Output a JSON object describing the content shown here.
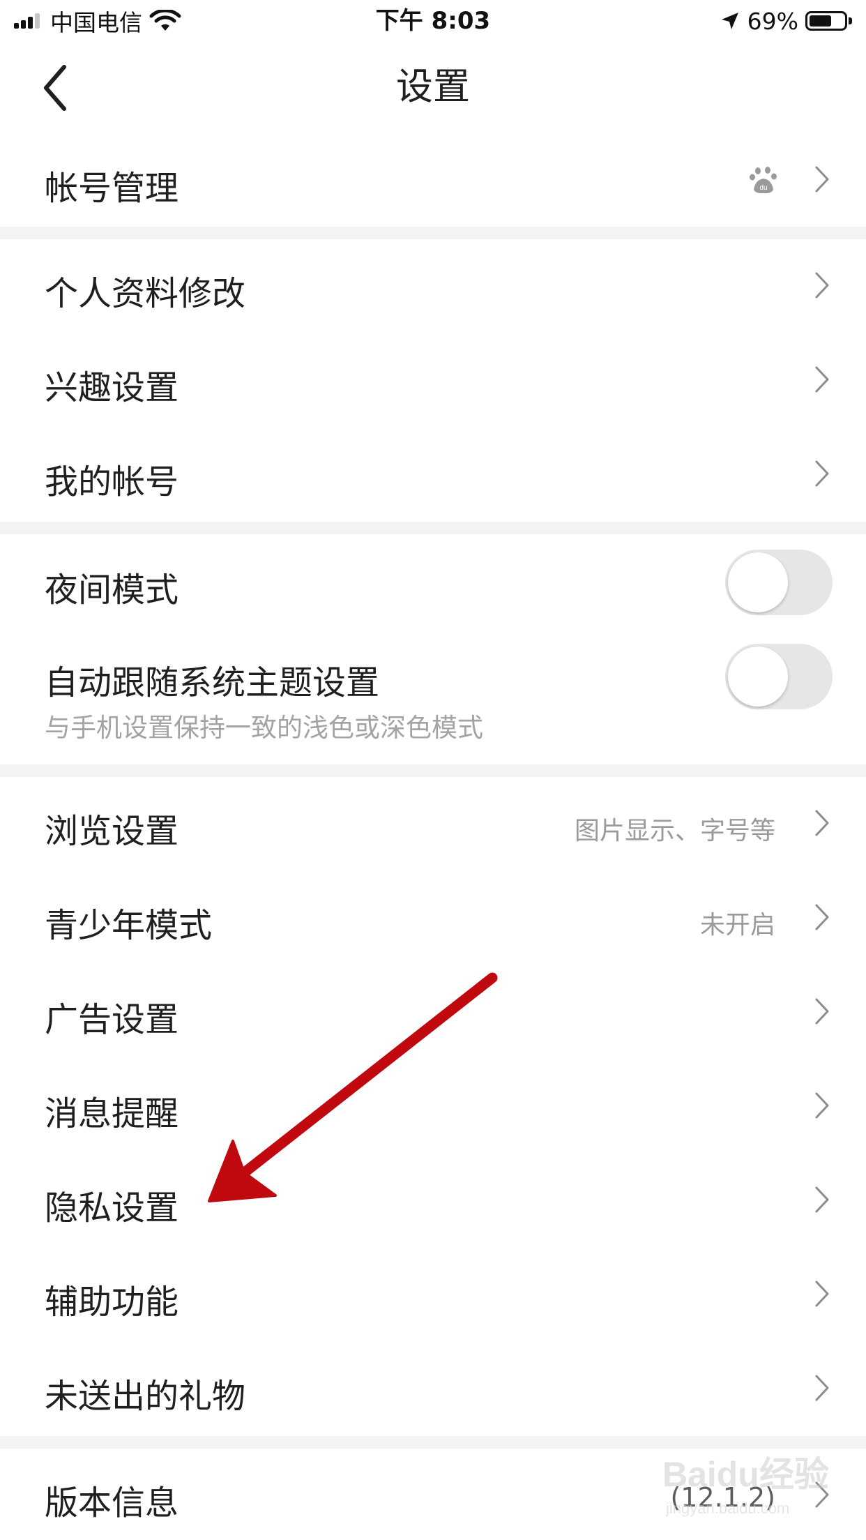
{
  "status_bar": {
    "carrier": "中国电信",
    "time": "下午 8:03",
    "battery_percent": "69%",
    "battery_level": 0.69
  },
  "nav": {
    "title": "设置",
    "back_icon": "chevron-left-icon"
  },
  "sections": {
    "account": {
      "label": "帐号管理",
      "icon": "baidu-paw-icon"
    },
    "profile": [
      {
        "label": "个人资料修改"
      },
      {
        "label": "兴趣设置"
      },
      {
        "label": "我的帐号"
      }
    ],
    "display": {
      "night_mode": {
        "label": "夜间模式",
        "enabled": false
      },
      "follow_system": {
        "label": "自动跟随系统主题设置",
        "sub": "与手机设置保持一致的浅色或深色模式",
        "enabled": false
      }
    },
    "general": [
      {
        "label": "浏览设置",
        "hint": "图片显示、字号等"
      },
      {
        "label": "青少年模式",
        "hint": "未开启"
      },
      {
        "label": "广告设置"
      },
      {
        "label": "消息提醒"
      },
      {
        "label": "隐私设置"
      },
      {
        "label": "辅助功能"
      },
      {
        "label": "未送出的礼物"
      }
    ],
    "version": {
      "label": "版本信息",
      "value": "(12.1.2)"
    }
  },
  "annotation": {
    "arrow_color": "#c0080f",
    "target": "隐私设置"
  },
  "watermark": {
    "logo": "Baidu经验",
    "url": "jingyan.baidu.com"
  },
  "colors": {
    "text": "#1f1f1f",
    "hint": "#9a9a9a",
    "divider": "#f3f3f3",
    "toggle_off": "#e6e6e6"
  }
}
